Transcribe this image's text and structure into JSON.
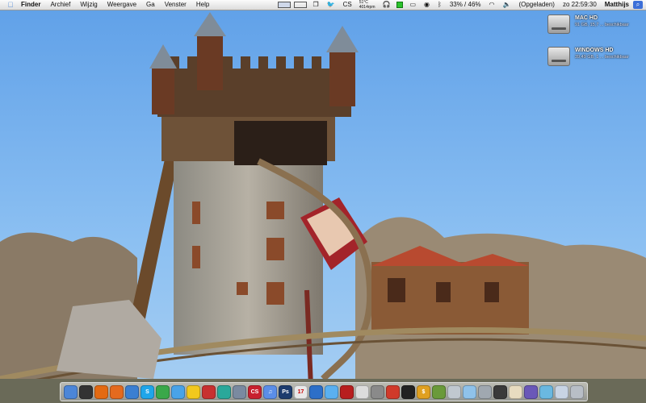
{
  "menubar": {
    "apple_icon": "apple-icon",
    "menus": [
      "Finder",
      "Archief",
      "Wijzig",
      "Weergave",
      "Ga",
      "Venster",
      "Help"
    ],
    "cpu_temp": "51°C",
    "fan_speed": "4014rpm",
    "cs_label": "CS",
    "cpu_usage": "33% / 46%",
    "battery_status": "(Opgeladen)",
    "clock": "zo 22:59:30",
    "user": "Matthijs"
  },
  "drives": [
    {
      "name": "MAC HD",
      "info": "91 GB, 15,7 ... beschikbaar"
    },
    {
      "name": "WINDOWS HD",
      "info": "39,49 GB, 1 ... beschikbaar"
    }
  ],
  "dock": {
    "items": [
      {
        "name": "finder",
        "color": "#4c86d8",
        "glyph": ""
      },
      {
        "name": "dashboard",
        "color": "#333333",
        "glyph": ""
      },
      {
        "name": "app-orange",
        "color": "#e36a12",
        "glyph": ""
      },
      {
        "name": "firefox",
        "color": "#e46a1e",
        "glyph": ""
      },
      {
        "name": "app-blue",
        "color": "#3b7fd1",
        "glyph": ""
      },
      {
        "name": "skype",
        "color": "#1fa6ea",
        "glyph": "S"
      },
      {
        "name": "adium",
        "color": "#3aa84a",
        "glyph": ""
      },
      {
        "name": "app-sky",
        "color": "#49a3e8",
        "glyph": ""
      },
      {
        "name": "app-yellow",
        "color": "#f2c81d",
        "glyph": ""
      },
      {
        "name": "app-red",
        "color": "#c83030",
        "glyph": ""
      },
      {
        "name": "app-teal",
        "color": "#2aa89a",
        "glyph": ""
      },
      {
        "name": "preview",
        "color": "#7a8aa0",
        "glyph": ""
      },
      {
        "name": "creative-suite",
        "color": "#c8202e",
        "glyph": "CS"
      },
      {
        "name": "itunes",
        "color": "#5b8ee8",
        "glyph": "♫"
      },
      {
        "name": "photoshop",
        "color": "#1d3c6e",
        "glyph": "Ps"
      },
      {
        "name": "ical",
        "color": "#e8e8e8",
        "glyph": "17"
      },
      {
        "name": "app-globe",
        "color": "#2c6fc8",
        "glyph": ""
      },
      {
        "name": "app-blue2",
        "color": "#5ab0f0",
        "glyph": ""
      },
      {
        "name": "app-red2",
        "color": "#b81e1e",
        "glyph": ""
      },
      {
        "name": "app-white",
        "color": "#dcdcdc",
        "glyph": ""
      },
      {
        "name": "app-grey",
        "color": "#8a8a8a",
        "glyph": ""
      },
      {
        "name": "app-red3",
        "color": "#d03a2a",
        "glyph": ""
      },
      {
        "name": "app-black",
        "color": "#222222",
        "glyph": ""
      },
      {
        "name": "app-gold",
        "color": "#e0a020",
        "glyph": "$"
      },
      {
        "name": "app-multi",
        "color": "#6a9a3a",
        "glyph": ""
      },
      {
        "name": "app-pale",
        "color": "#c0c8d0",
        "glyph": ""
      },
      {
        "name": "app-lightblue",
        "color": "#8fc2ea",
        "glyph": ""
      },
      {
        "name": "app-silver",
        "color": "#a0a8b0",
        "glyph": ""
      },
      {
        "name": "app-dark",
        "color": "#3a3a3a",
        "glyph": ""
      },
      {
        "name": "app-cream",
        "color": "#e8dcc0",
        "glyph": ""
      },
      {
        "name": "app-purple",
        "color": "#6a58b8",
        "glyph": ""
      },
      {
        "name": "app-aqua",
        "color": "#6ab8e0",
        "glyph": ""
      },
      {
        "name": "downloads-stack",
        "color": "#c8d4e4",
        "glyph": ""
      },
      {
        "name": "trash",
        "color": "#b8bec6",
        "glyph": ""
      }
    ]
  }
}
